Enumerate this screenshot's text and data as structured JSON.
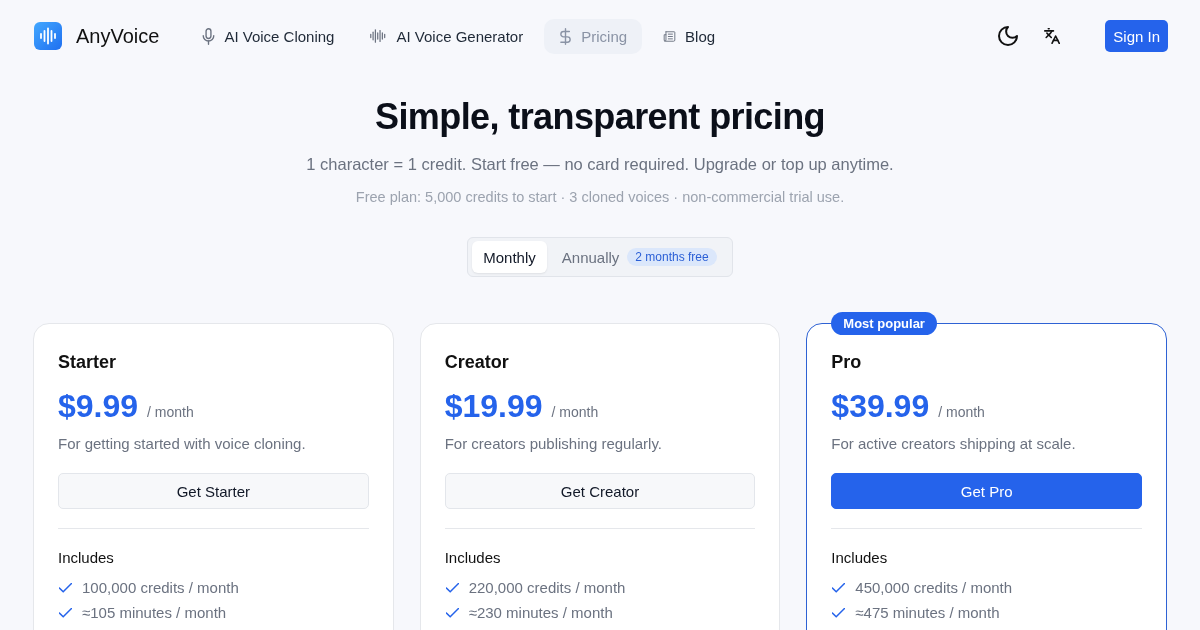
{
  "brand": {
    "name": "AnyVoice"
  },
  "nav": [
    {
      "label": "AI Voice Cloning",
      "selected": false
    },
    {
      "label": "AI Voice Generator",
      "selected": false
    },
    {
      "label": "Pricing",
      "selected": true
    },
    {
      "label": "Blog",
      "selected": false
    }
  ],
  "header_actions": {
    "sign_in": "Sign In"
  },
  "hero": {
    "title": "Simple, transparent pricing",
    "subtitle": "1 character = 1 credit. Start free — no card required. Upgrade or top up anytime.",
    "note": "Free plan: 5,000 credits to start · 3 cloned voices · non-commercial trial use."
  },
  "billing_toggle": {
    "options": [
      {
        "label": "Monthly",
        "selected": true
      },
      {
        "label": "Annually",
        "selected": false,
        "badge": "2 months free"
      }
    ]
  },
  "plans": [
    {
      "name": "Starter",
      "price": "$9.99",
      "period": "/ month",
      "description": "For getting started with voice cloning.",
      "cta": "Get Starter",
      "highlighted": false,
      "includes_title": "Includes",
      "features": [
        "100,000 credits / month",
        "≈105 minutes / month"
      ]
    },
    {
      "name": "Creator",
      "price": "$19.99",
      "period": "/ month",
      "description": "For creators publishing regularly.",
      "cta": "Get Creator",
      "highlighted": false,
      "includes_title": "Includes",
      "features": [
        "220,000 credits / month",
        "≈230 minutes / month"
      ]
    },
    {
      "name": "Pro",
      "badge": "Most popular",
      "price": "$39.99",
      "period": "/ month",
      "description": "For active creators shipping at scale.",
      "cta": "Get Pro",
      "highlighted": true,
      "includes_title": "Includes",
      "features": [
        "450,000 credits / month",
        "≈475 minutes / month"
      ]
    }
  ]
}
